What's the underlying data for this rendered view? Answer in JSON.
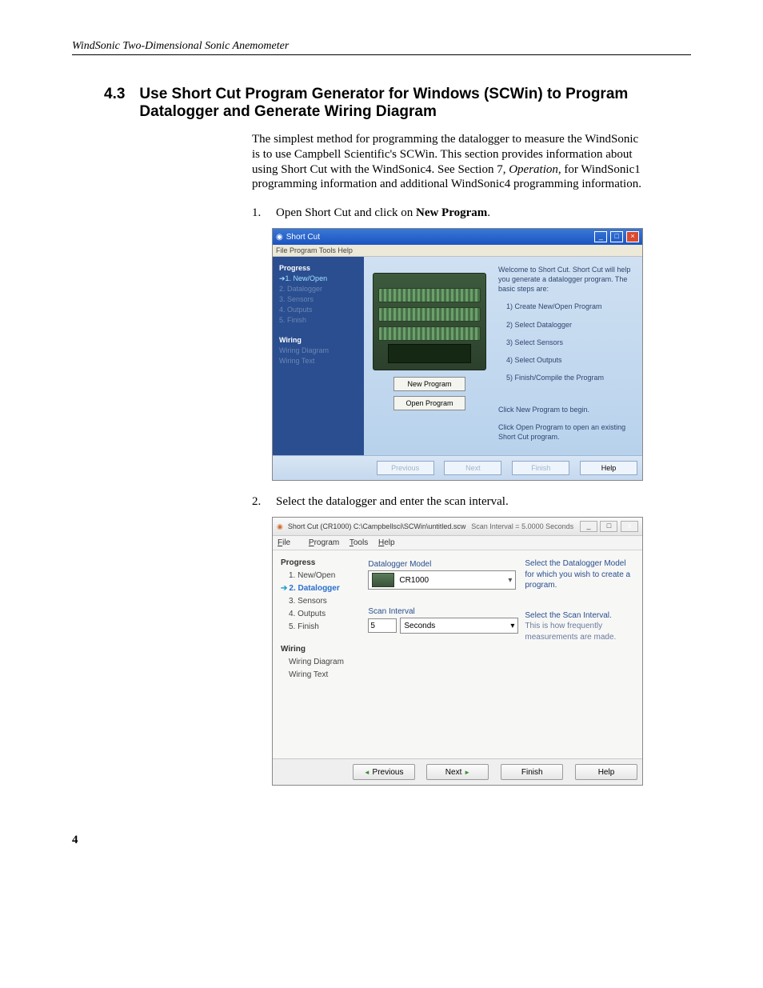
{
  "running_header": "WindSonic Two-Dimensional Sonic Anemometer",
  "page_number": "4",
  "section": {
    "number": "4.3",
    "title": "Use Short Cut Program Generator for Windows (SCWin) to Program Datalogger and Generate Wiring Diagram"
  },
  "intro_para_a": "The simplest method for programming the datalogger to measure the WindSonic is to use Campbell Scientific's SCWin.  This section provides information about using Short Cut with the WindSonic4.  See Section 7, ",
  "intro_para_b_ital": "Operation",
  "intro_para_c": ", for WindSonic1 programming information and additional WindSonic4 programming information.",
  "steps": {
    "s1_idx": "1.",
    "s1_a": "Open Short Cut and click on ",
    "s1_b_bold": "New Program",
    "s1_c": ".",
    "s2_idx": "2.",
    "s2": "Select the datalogger and enter the scan interval."
  },
  "win1": {
    "title": "Short Cut",
    "menu": "File  Program  Tools  Help",
    "sidebar": {
      "head1": "Progress",
      "i1": "1. New/Open",
      "i2": "2. Datalogger",
      "i3": "3. Sensors",
      "i4": "4. Outputs",
      "i5": "5. Finish",
      "head2": "Wiring",
      "w1": "Wiring Diagram",
      "w2": "Wiring Text"
    },
    "btn_new": "New Program",
    "btn_open": "Open Program",
    "right": {
      "welcome": "Welcome to Short Cut.  Short Cut will help you generate a datalogger program.  The basic steps are:",
      "l1": "1) Create New/Open Program",
      "l2": "2) Select Datalogger",
      "l3": "3) Select Sensors",
      "l4": "4) Select Outputs",
      "l5": "5) Finish/Compile the Program",
      "begin": "Click New Program to begin.",
      "open": "Click Open Program to open an existing Short Cut program."
    },
    "footer": {
      "prev": "Previous",
      "next": "Next",
      "finish": "Finish",
      "help": "Help"
    }
  },
  "win2": {
    "title": "Short Cut (CR1000) C:\\Campbellsci\\SCWin\\untitled.scw",
    "title_mid": "Scan Interval = 5.0000 Seconds",
    "menu": {
      "file": "File",
      "program": "Program",
      "tools": "Tools",
      "help": "Help"
    },
    "sidebar": {
      "head1": "Progress",
      "i1": "1. New/Open",
      "i2": "2. Datalogger",
      "i3": "3. Sensors",
      "i4": "4. Outputs",
      "i5": "5. Finish",
      "head2": "Wiring",
      "w1": "Wiring Diagram",
      "w2": "Wiring Text"
    },
    "lbl_model": "Datalogger Model",
    "model_value": "CR1000",
    "lbl_scan": "Scan Interval",
    "scan_value": "5",
    "scan_units": "Seconds",
    "right": {
      "r1": "Select the Datalogger Model for which you wish to create a program.",
      "r2a": "Select the Scan Interval.",
      "r2b": "This is how frequently measurements are made."
    },
    "footer": {
      "prev": "Previous",
      "next": "Next",
      "finish": "Finish",
      "help": "Help"
    }
  }
}
